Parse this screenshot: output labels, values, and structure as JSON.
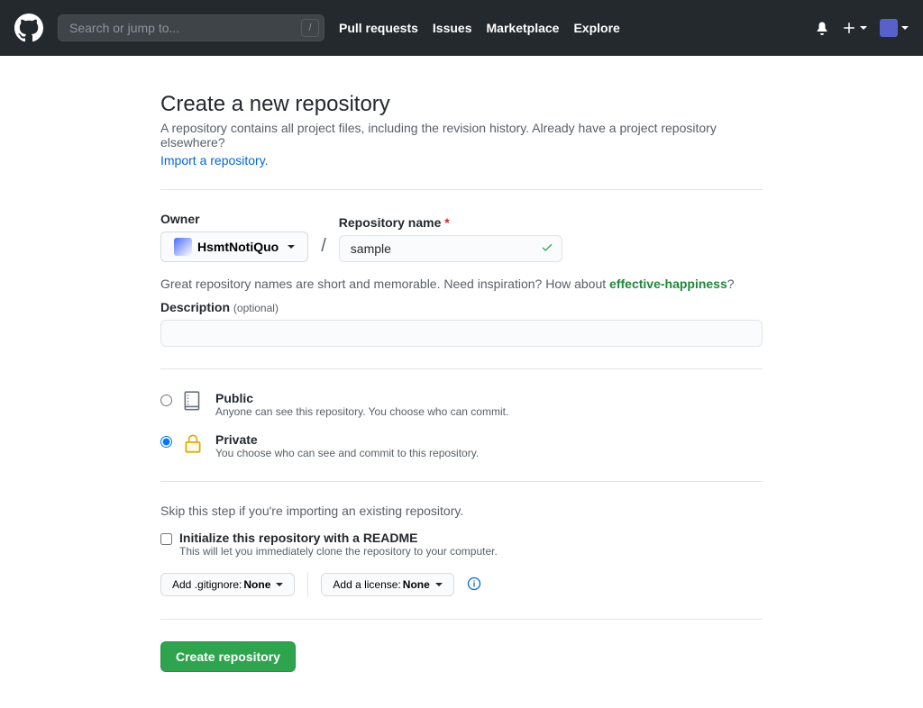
{
  "header": {
    "search_placeholder": "Search or jump to...",
    "nav": {
      "pull_requests": "Pull requests",
      "issues": "Issues",
      "marketplace": "Marketplace",
      "explore": "Explore"
    }
  },
  "page": {
    "title": "Create a new repository",
    "subhead": "A repository contains all project files, including the revision history. Already have a project repository elsewhere?",
    "import_link": "Import a repository."
  },
  "form": {
    "owner_label": "Owner",
    "owner_name": "HsmtNotiQuo",
    "slash": "/",
    "repo_name_label": "Repository name",
    "repo_name_value": "sample",
    "hint_prefix": "Great repository names are short and memorable. Need inspiration? How about ",
    "suggestion": "effective-happiness",
    "hint_suffix": "?",
    "description_label": "Description",
    "optional": "(optional)",
    "description_value": ""
  },
  "visibility": {
    "public": {
      "title": "Public",
      "desc": "Anyone can see this repository. You choose who can commit."
    },
    "private": {
      "title": "Private",
      "desc": "You choose who can see and commit to this repository."
    }
  },
  "init": {
    "skip_text": "Skip this step if you're importing an existing repository.",
    "readme_title": "Initialize this repository with a README",
    "readme_desc": "This will let you immediately clone the repository to your computer.",
    "gitignore_label": "Add .gitignore: ",
    "gitignore_value": "None",
    "license_label": "Add a license: ",
    "license_value": "None"
  },
  "submit": {
    "label": "Create repository"
  }
}
